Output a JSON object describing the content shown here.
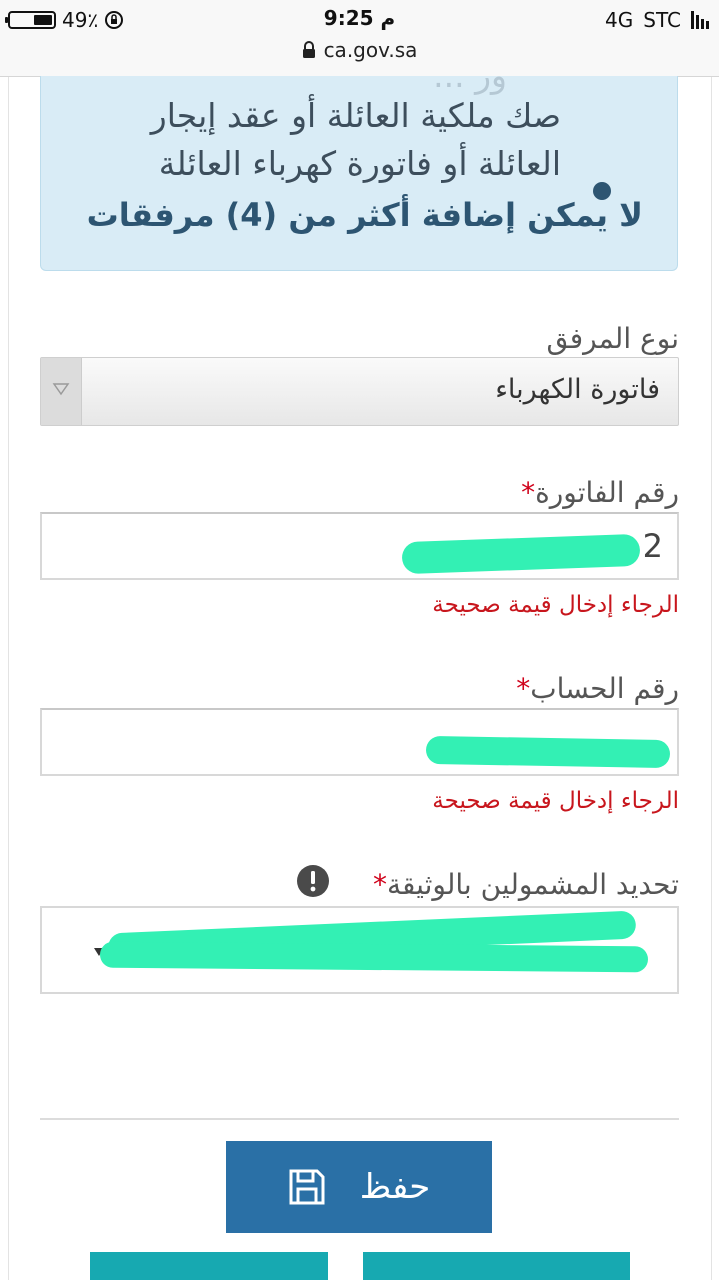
{
  "status_bar": {
    "battery": "49٪",
    "time": "9:25 م",
    "network": "4G",
    "carrier": "STC",
    "url": "ca.gov.sa"
  },
  "info_box": {
    "cut_line": "ور ...",
    "line1": "صك ملكية العائلة أو عقد إيجار",
    "line2": "العائلة أو فاتورة كهرباء العائلة",
    "bold_note": "لا يمكن إضافة أكثر من (4) مرفقات"
  },
  "form": {
    "attachment_type_label": "نوع المرفق",
    "attachment_type_value": "فاتورة الكهرباء",
    "invoice_label": "رقم الفاتورة",
    "invoice_value": "2",
    "invoice_error": "الرجاء إدخال قيمة صحيحة",
    "account_label": "رقم الحساب",
    "account_value": "",
    "account_error": "الرجاء إدخال قيمة صحيحة",
    "beneficiaries_label": "تحديد المشمولين بالوثيقة",
    "required_mark": "*",
    "save_label": "حفظ"
  },
  "colors": {
    "primary_button": "#2a70a6",
    "error": "#c8161d",
    "info_bg": "#d9ecf6",
    "secondary_button": "#17a9b1"
  }
}
